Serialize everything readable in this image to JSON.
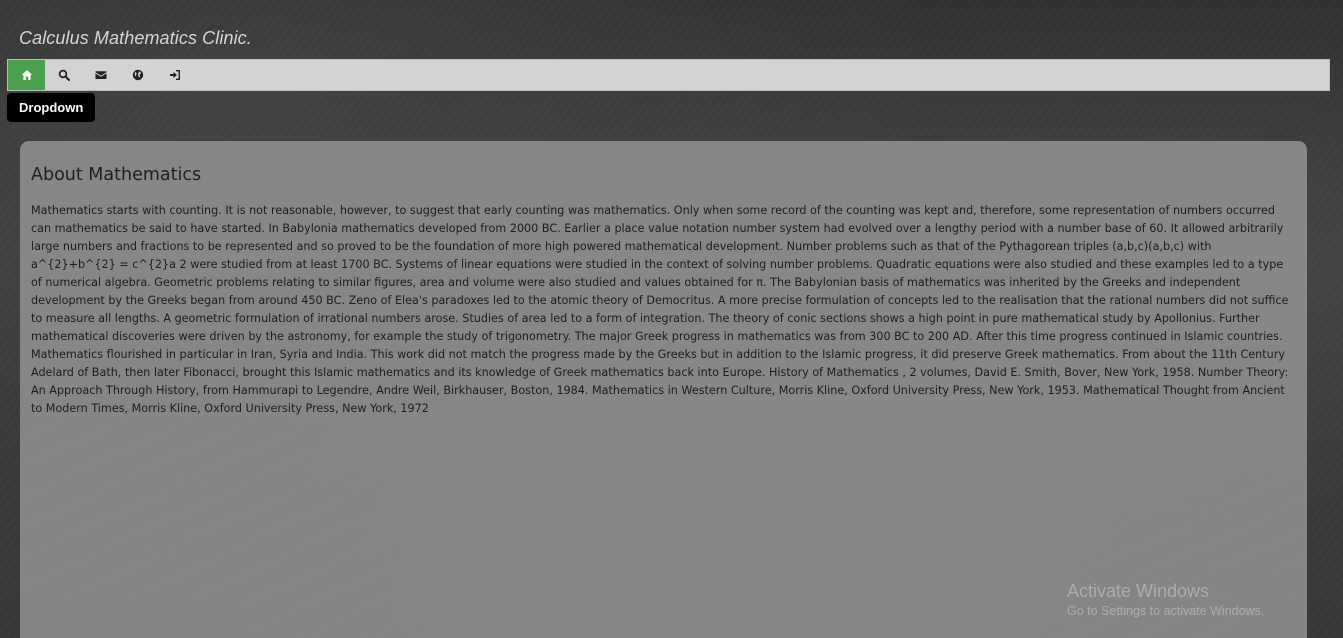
{
  "header": {
    "site_title": "Calculus Mathematics Clinic."
  },
  "navbar": {
    "items": [
      {
        "icon": "home-icon",
        "active": true
      },
      {
        "icon": "search-icon",
        "active": false
      },
      {
        "icon": "envelope-icon",
        "active": false
      },
      {
        "icon": "globe-icon",
        "active": false
      },
      {
        "icon": "sign-in-icon",
        "active": false
      }
    ],
    "active_color": "#4aa04e",
    "background_color": "#d3d3d3"
  },
  "tooltip": {
    "label": "Dropdown"
  },
  "article": {
    "title": "About Mathematics",
    "body": "Mathematics starts with counting. It is not reasonable, however, to suggest that early counting was mathematics. Only when some record of the counting was kept and, therefore, some representation of numbers occurred can mathematics be said to have started. In Babylonia mathematics developed from 2000 BC. Earlier a place value notation number system had evolved over a lengthy period with a number base of 60. It allowed arbitrarily large numbers and fractions to be represented and so proved to be the foundation of more high powered mathematical development. Number problems such as that of the Pythagorean triples (a,b,c)(a,b,c) with a^{2}+b^{2} = c^{2}a 2 were studied from at least 1700 BC. Systems of linear equations were studied in the context of solving number problems. Quadratic equations were also studied and these examples led to a type of numerical algebra. Geometric problems relating to similar figures, area and volume were also studied and values obtained for π. The Babylonian basis of mathematics was inherited by the Greeks and independent development by the Greeks began from around 450 BC. Zeno of Elea's paradoxes led to the atomic theory of Democritus. A more precise formulation of concepts led to the realisation that the rational numbers did not suffice to measure all lengths. A geometric formulation of irrational numbers arose. Studies of area led to a form of integration. The theory of conic sections shows a high point in pure mathematical study by Apollonius. Further mathematical discoveries were driven by the astronomy, for example the study of trigonometry. The major Greek progress in mathematics was from 300 BC to 200 AD. After this time progress continued in Islamic countries. Mathematics flourished in particular in Iran, Syria and India. This work did not match the progress made by the Greeks but in addition to the Islamic progress, it did preserve Greek mathematics. From about the 11th Century Adelard of Bath, then later Fibonacci, brought this Islamic mathematics and its knowledge of Greek mathematics back into Europe. History of Mathematics , 2 volumes, David E. Smith, Bover, New York, 1958. Number Theory: An Approach Through History, from Hammurapi to Legendre, Andre Weil, Birkhauser, Boston, 1984. Mathematics in Western Culture, Morris Kline, Oxford University Press, New York, 1953. Mathematical Thought from Ancient to Modern Times, Morris Kline, Oxford University Press, New York, 1972"
  },
  "watermark": {
    "title": "Activate Windows",
    "subtitle": "Go to Settings to activate Windows."
  }
}
